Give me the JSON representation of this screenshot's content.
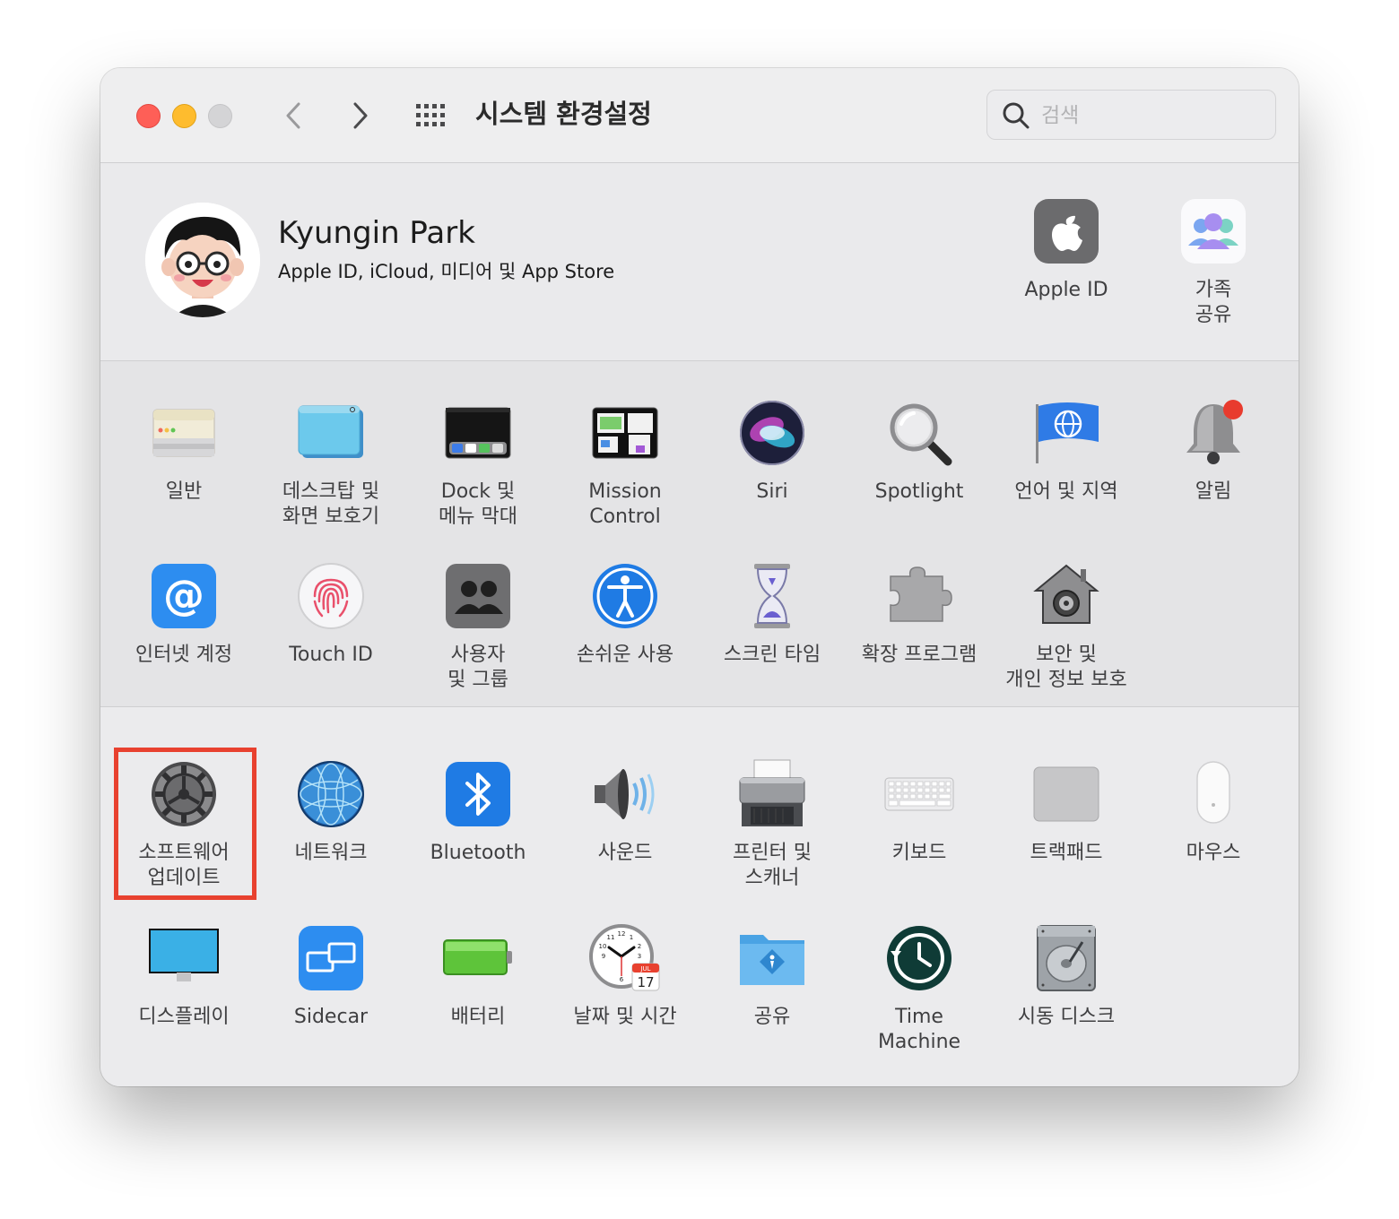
{
  "window": {
    "title": "시스템 환경설정",
    "search_placeholder": "검색"
  },
  "account": {
    "name": "Kyungin Park",
    "subtitle": "Apple ID, iCloud, 미디어 및 App Store",
    "apple_id_label": "Apple ID",
    "family_label": "가족\n공유"
  },
  "prefs": {
    "general": "일반",
    "desktop": "데스크탑 및\n화면 보호기",
    "dock": "Dock 및\n메뉴 막대",
    "mission_control": "Mission\nControl",
    "siri": "Siri",
    "spotlight": "Spotlight",
    "language": "언어 및 지역",
    "notifications": "알림",
    "internet_accounts": "인터넷 계정",
    "touch_id": "Touch ID",
    "users": "사용자\n및 그룹",
    "accessibility": "손쉬운 사용",
    "screen_time": "스크린 타임",
    "extensions": "확장 프로그램",
    "security": "보안 및\n개인 정보 보호",
    "software_update": "소프트웨어\n업데이트",
    "network": "네트워크",
    "bluetooth": "Bluetooth",
    "sound": "사운드",
    "printers": "프린터 및\n스캐너",
    "keyboard": "키보드",
    "trackpad": "트랙패드",
    "mouse": "마우스",
    "displays": "디스플레이",
    "sidecar": "Sidecar",
    "battery": "배터리",
    "date_time": "날짜 및 시간",
    "sharing": "공유",
    "time_machine": "Time\nMachine",
    "startup_disk": "시동 디스크"
  },
  "date_icon": {
    "month": "JUL",
    "day": "17"
  },
  "highlight_color": "#e8412f"
}
